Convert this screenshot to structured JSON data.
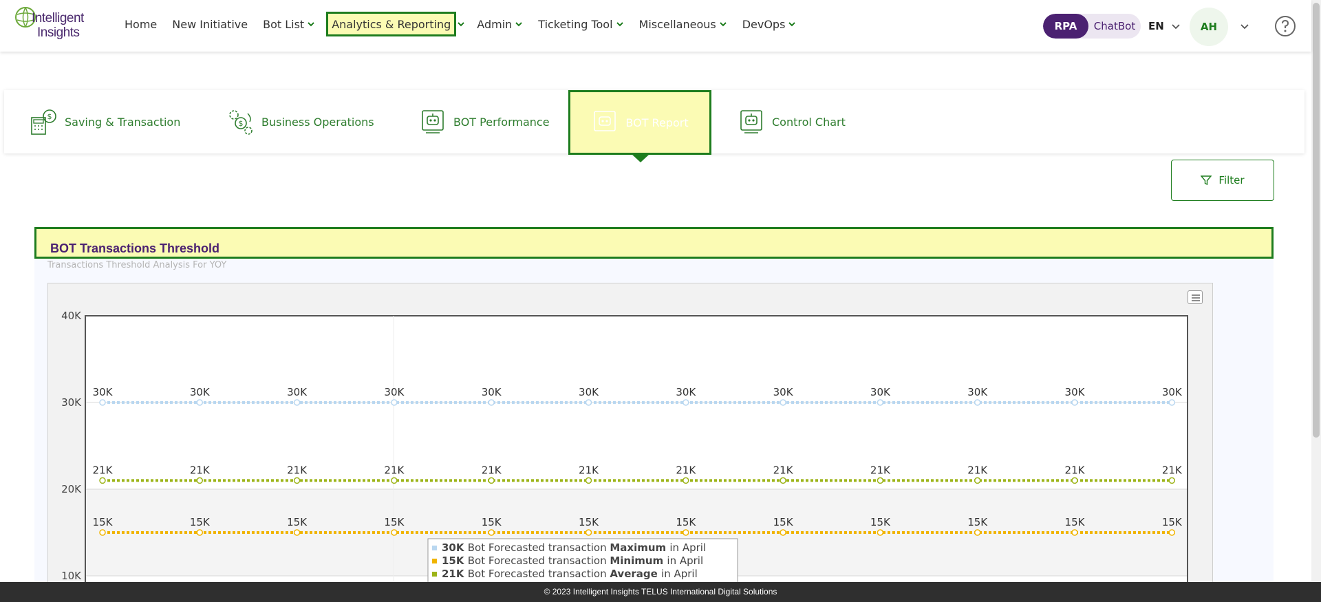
{
  "logo": {
    "line1": "Intelligent",
    "line2": "Insights"
  },
  "nav": {
    "home": "Home",
    "new_initiative": "New Initiative",
    "bot_list": "Bot List",
    "analytics": "Analytics & Reporting",
    "admin": "Admin",
    "ticketing": "Ticketing Tool",
    "misc": "Miscellaneous",
    "devops": "DevOps"
  },
  "header_right": {
    "rpa": "RPA",
    "chatbot": "ChatBot",
    "lang": "EN",
    "avatar_initials": "AH"
  },
  "tabs": [
    {
      "label": "Saving & Transaction",
      "icon": "calculator-money-icon"
    },
    {
      "label": "Business Operations",
      "icon": "gears-dollar-icon"
    },
    {
      "label": "BOT Performance",
      "icon": "robot-report-icon"
    },
    {
      "label": "BOT Report",
      "icon": "robot-report-icon",
      "active": true
    },
    {
      "label": "Control Chart",
      "icon": "robot-report-icon"
    }
  ],
  "filter_label": "Filter",
  "panel": {
    "title": "BOT Transactions Threshold",
    "subtitle": "Transactions Threshold Analysis For YOY"
  },
  "colors": {
    "accent_green": "#1e7d1e",
    "purple": "#4b2171",
    "highlight": "#fbfbb4"
  },
  "chart_data": {
    "type": "line",
    "y_ticks": [
      "40K",
      "30K",
      "20K",
      "10K"
    ],
    "ylim": [
      10000,
      40000
    ],
    "point_count": 12,
    "series": [
      {
        "value_label": "30K",
        "values": [
          30000,
          30000,
          30000,
          30000,
          30000,
          30000,
          30000,
          30000,
          30000,
          30000,
          30000,
          30000
        ],
        "color": "#b9d7f0"
      },
      {
        "value_label": "21K",
        "values": [
          21000,
          21000,
          21000,
          21000,
          21000,
          21000,
          21000,
          21000,
          21000,
          21000,
          21000,
          21000
        ],
        "color": "#9cb418"
      },
      {
        "value_label": "15K",
        "values": [
          15000,
          15000,
          15000,
          15000,
          15000,
          15000,
          15000,
          15000,
          15000,
          15000,
          15000,
          15000
        ],
        "color": "#f0b400"
      }
    ],
    "legend": [
      {
        "value": "30K",
        "pre": "Bot Forecasted transaction",
        "bold": "Maximum",
        "post": "in April",
        "color": "#b9d7f0"
      },
      {
        "value": "15K",
        "pre": "Bot Forecasted transaction",
        "bold": "Minimum",
        "post": "in April",
        "color": "#f0b400"
      },
      {
        "value": "21K",
        "pre": "Bot Forecasted transaction",
        "bold": "Average",
        "post": "in April",
        "color": "#9cb418"
      }
    ]
  },
  "footer": "© 2023 Intelligent Insights TELUS International Digital Solutions"
}
